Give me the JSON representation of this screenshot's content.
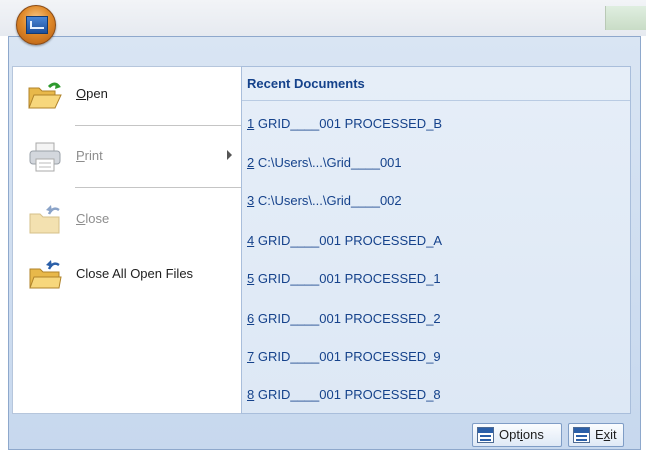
{
  "app": {
    "button_icon": "app-menu-icon"
  },
  "left_menu": [
    {
      "name": "open",
      "accel": "O",
      "rest": "pen",
      "enabled": true,
      "icon": "open-folder-icon"
    },
    {
      "name": "print",
      "accel": "P",
      "rest": "rint",
      "enabled": false,
      "icon": "printer-icon",
      "has_submenu": true
    },
    {
      "name": "close",
      "accel": "C",
      "rest": "lose",
      "enabled": false,
      "icon": "close-file-icon"
    },
    {
      "name": "close-all",
      "label": "Close All Open Files",
      "enabled": true,
      "icon": "close-all-files-icon"
    }
  ],
  "recent": {
    "header": "Recent Documents",
    "items": [
      {
        "num": "1",
        "text": " GRID____001 PROCESSED_B"
      },
      {
        "num": "2",
        "text": " C:\\Users\\...\\Grid____001"
      },
      {
        "num": "3",
        "text": " C:\\Users\\...\\Grid____002"
      },
      {
        "num": "4",
        "text": " GRID____001 PROCESSED_A"
      },
      {
        "num": "5",
        "text": " GRID____001 PROCESSED_1"
      },
      {
        "num": "6",
        "text": " GRID____001 PROCESSED_2"
      },
      {
        "num": "7",
        "text": " GRID____001 PROCESSED_9"
      },
      {
        "num": "8",
        "text": " GRID____001 PROCESSED_8"
      }
    ]
  },
  "footer": {
    "options": {
      "pre": "Opt",
      "accel": "i",
      "post": "ons",
      "icon": "csv-options-icon"
    },
    "exit": {
      "pre": "E",
      "accel": "x",
      "post": "it",
      "icon": "hdr-exit-icon"
    }
  }
}
